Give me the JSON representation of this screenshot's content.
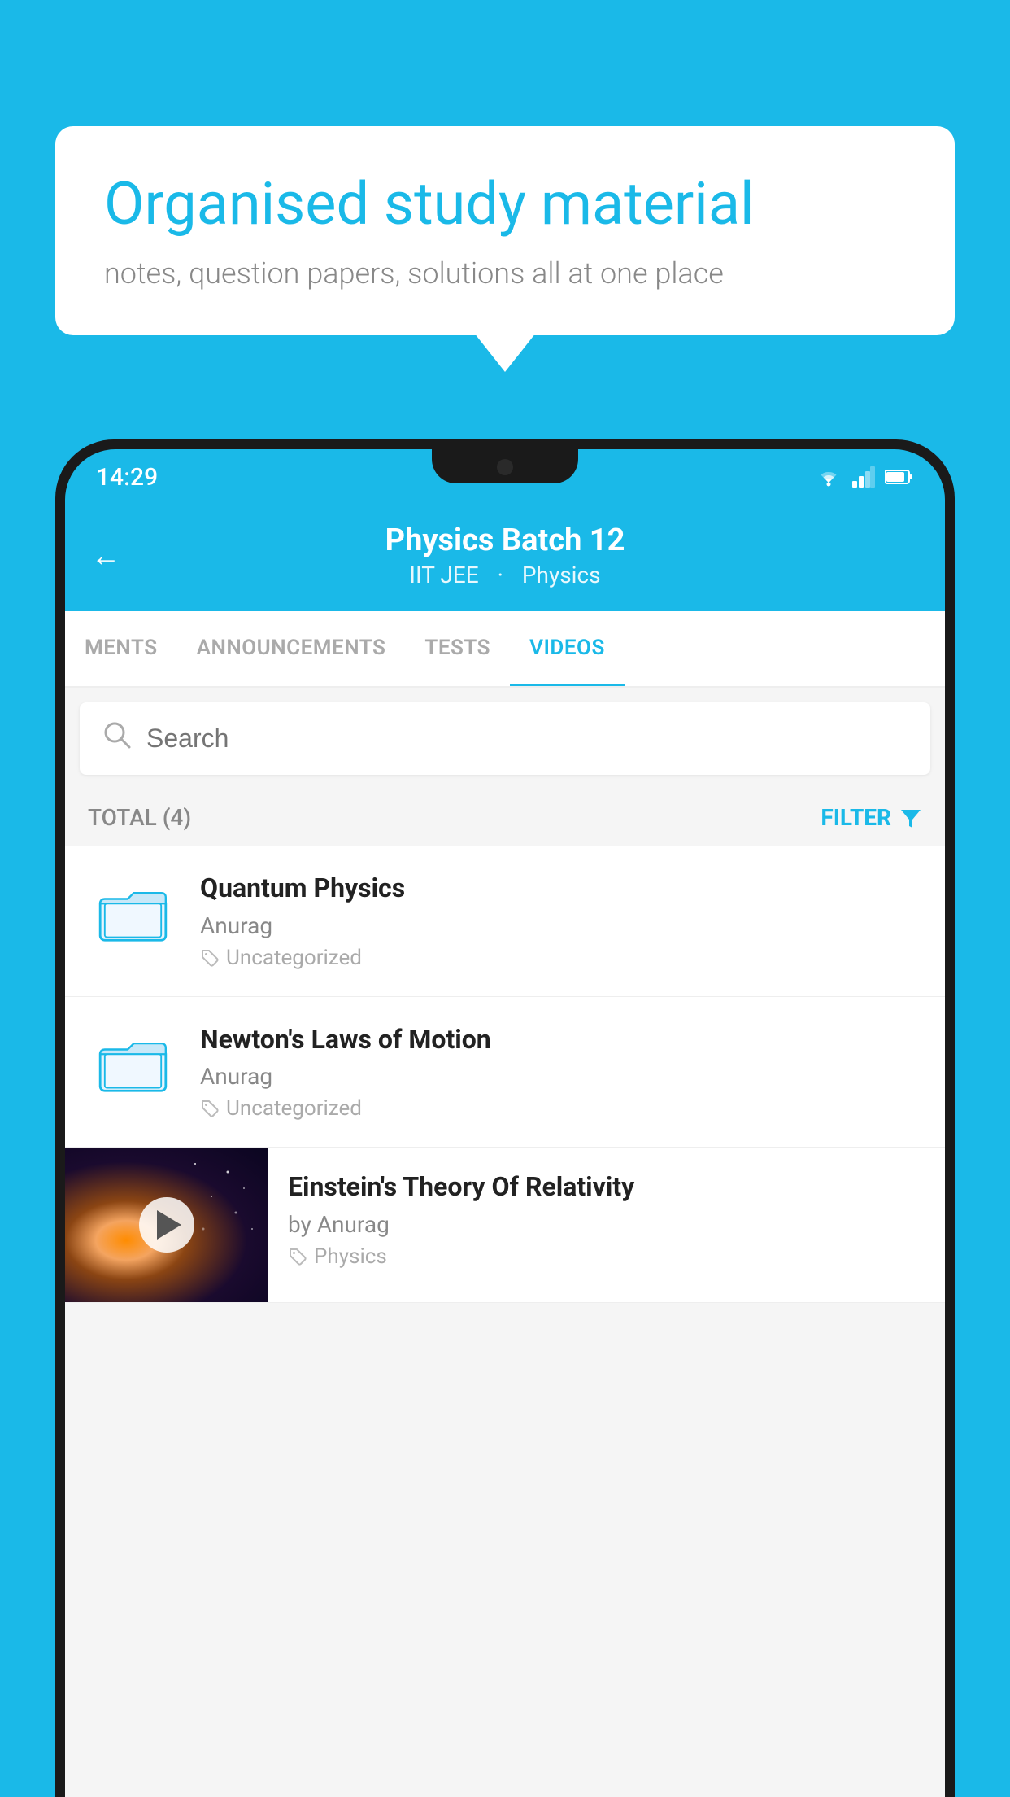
{
  "background_color": "#1ab9e8",
  "speech_bubble": {
    "heading": "Organised study material",
    "subtext": "notes, question papers, solutions all at one place"
  },
  "phone": {
    "status_bar": {
      "time": "14:29",
      "wifi_icon": "wifi",
      "signal_icon": "signal",
      "battery_icon": "battery"
    },
    "header": {
      "back_label": "←",
      "title": "Physics Batch 12",
      "subtitle_left": "IIT JEE",
      "subtitle_right": "Physics"
    },
    "tabs": [
      {
        "label": "MENTS",
        "active": false
      },
      {
        "label": "ANNOUNCEMENTS",
        "active": false
      },
      {
        "label": "TESTS",
        "active": false
      },
      {
        "label": "VIDEOS",
        "active": true
      }
    ],
    "search": {
      "placeholder": "Search"
    },
    "filter_bar": {
      "total_label": "TOTAL (4)",
      "filter_label": "FILTER"
    },
    "videos": [
      {
        "title": "Quantum Physics",
        "author": "Anurag",
        "tag": "Uncategorized",
        "has_thumbnail": false
      },
      {
        "title": "Newton's Laws of Motion",
        "author": "Anurag",
        "tag": "Uncategorized",
        "has_thumbnail": false
      },
      {
        "title": "Einstein's Theory Of Relativity",
        "author": "by Anurag",
        "tag": "Physics",
        "has_thumbnail": true
      }
    ]
  }
}
